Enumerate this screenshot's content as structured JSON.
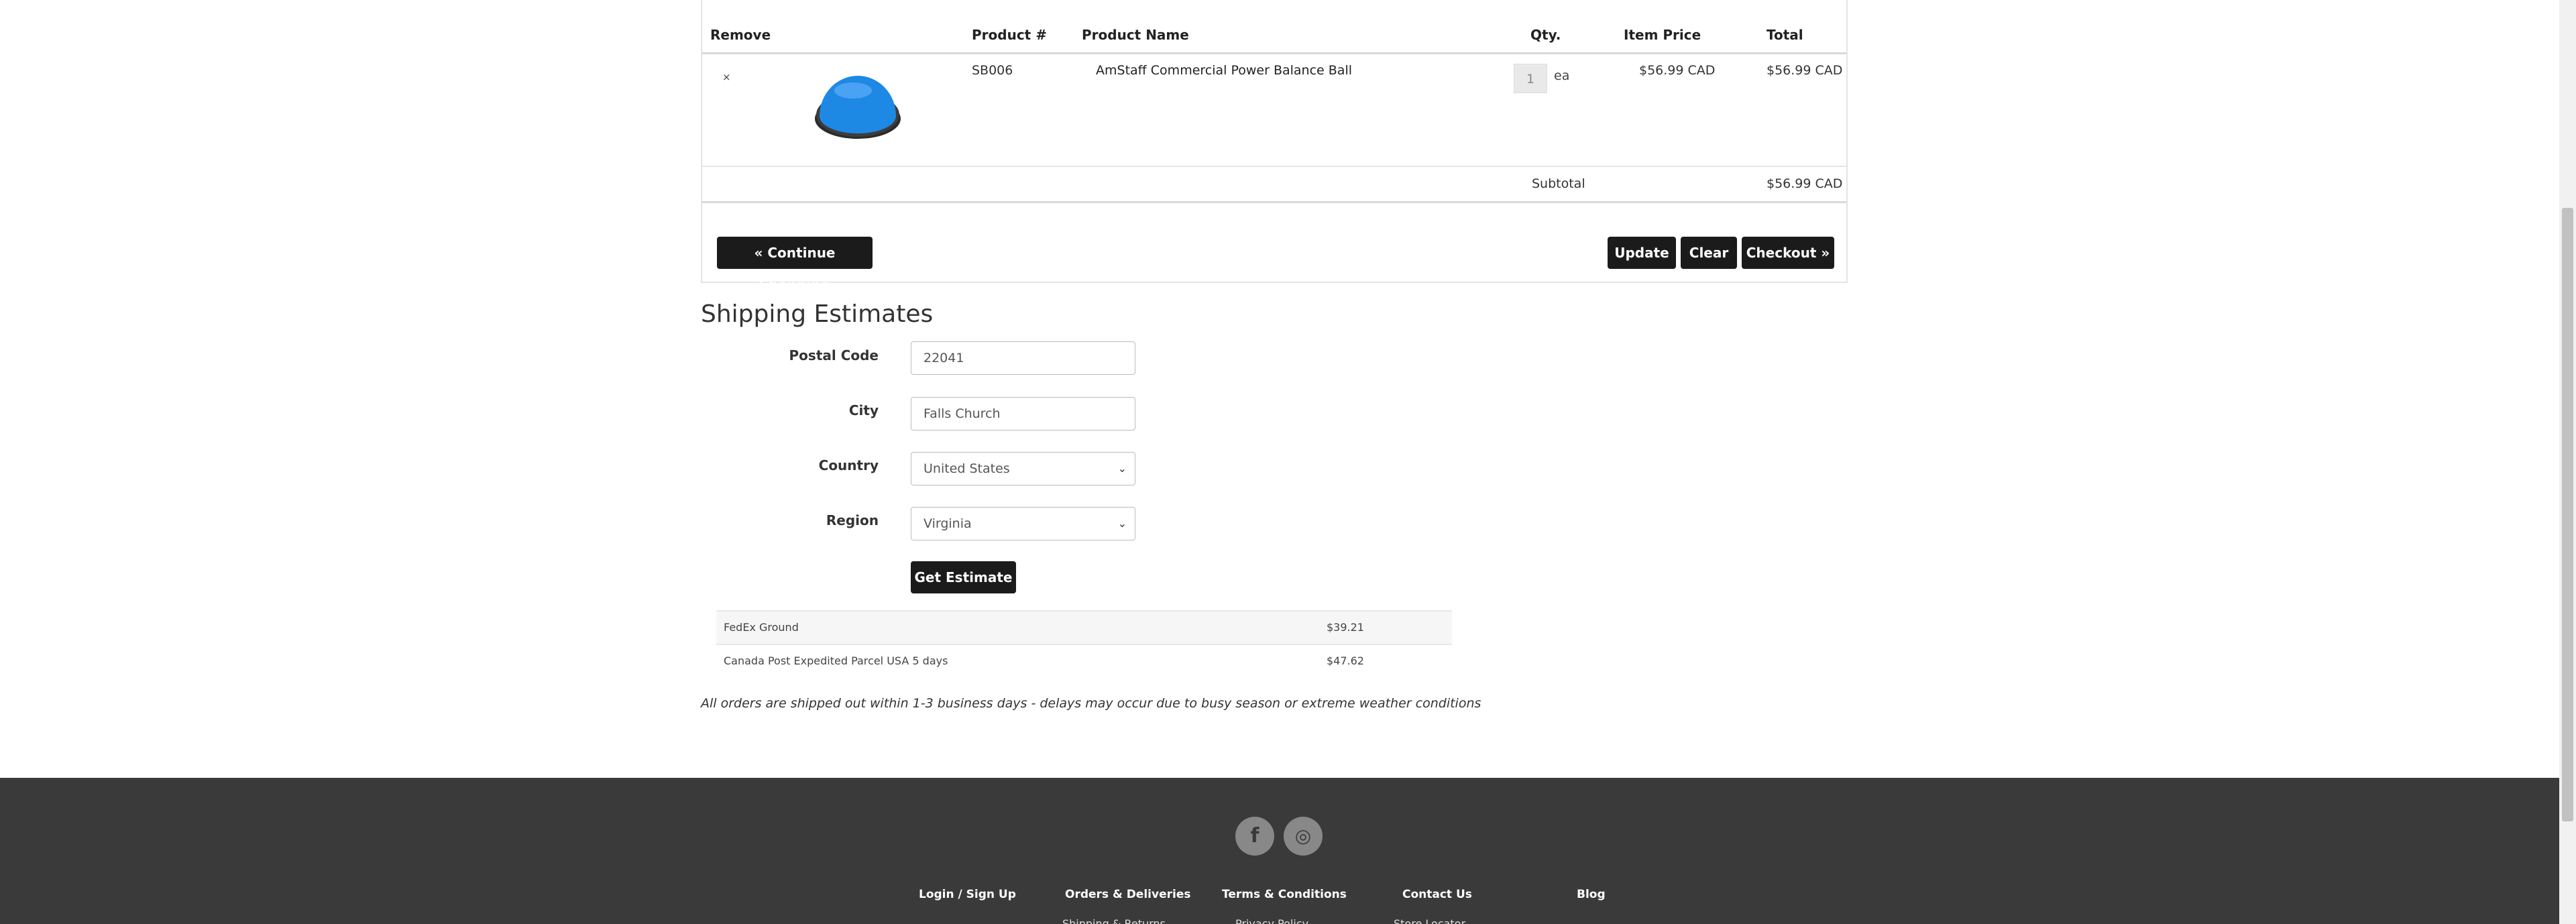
{
  "cart": {
    "headers": {
      "remove": "Remove",
      "product_no": "Product #",
      "product_name": "Product Name",
      "qty": "Qty.",
      "item_price": "Item Price",
      "total": "Total"
    },
    "items": [
      {
        "remove_icon": "×",
        "product_no": "SB006",
        "product_name": "AmStaff Commercial Power Balance Ball",
        "qty": "1",
        "unit": "ea",
        "item_price": "$56.99 CAD",
        "total": "$56.99 CAD"
      }
    ],
    "subtotal_label": "Subtotal",
    "subtotal_value": "$56.99 CAD",
    "buttons": {
      "continue": "« Continue Shopping",
      "update": "Update",
      "clear": "Clear",
      "checkout": "Checkout »"
    }
  },
  "shipping": {
    "title": "Shipping Estimates",
    "postal_label": "Postal Code",
    "postal_value": "22041",
    "city_label": "City",
    "city_value": "Falls Church",
    "country_label": "Country",
    "country_value": "United States",
    "region_label": "Region",
    "region_value": "Virginia",
    "estimate_button": "Get Estimate",
    "rates": [
      {
        "name": "FedEx Ground",
        "price": "$39.21"
      },
      {
        "name": "Canada Post Expedited Parcel USA 5 days",
        "price": "$47.62"
      }
    ],
    "note": "All orders are shipped out within 1-3 business days - delays may occur due to busy season or extreme weather conditions"
  },
  "footer": {
    "social": [
      {
        "icon": "facebook-icon",
        "glyph": "f"
      },
      {
        "icon": "instagram-icon",
        "glyph": "◎"
      }
    ],
    "links": [
      "Login / Sign Up",
      "Orders & Deliveries",
      "Terms & Conditions",
      "Contact Us",
      "Blog"
    ],
    "sublinks": [
      "Shipping & Returns",
      "Privacy Policy",
      "Store Locator"
    ]
  },
  "colors": {
    "button_bg": "#1b1b1b",
    "footer_bg": "#3a3a3a",
    "ball_blue": "#1e88e5"
  }
}
